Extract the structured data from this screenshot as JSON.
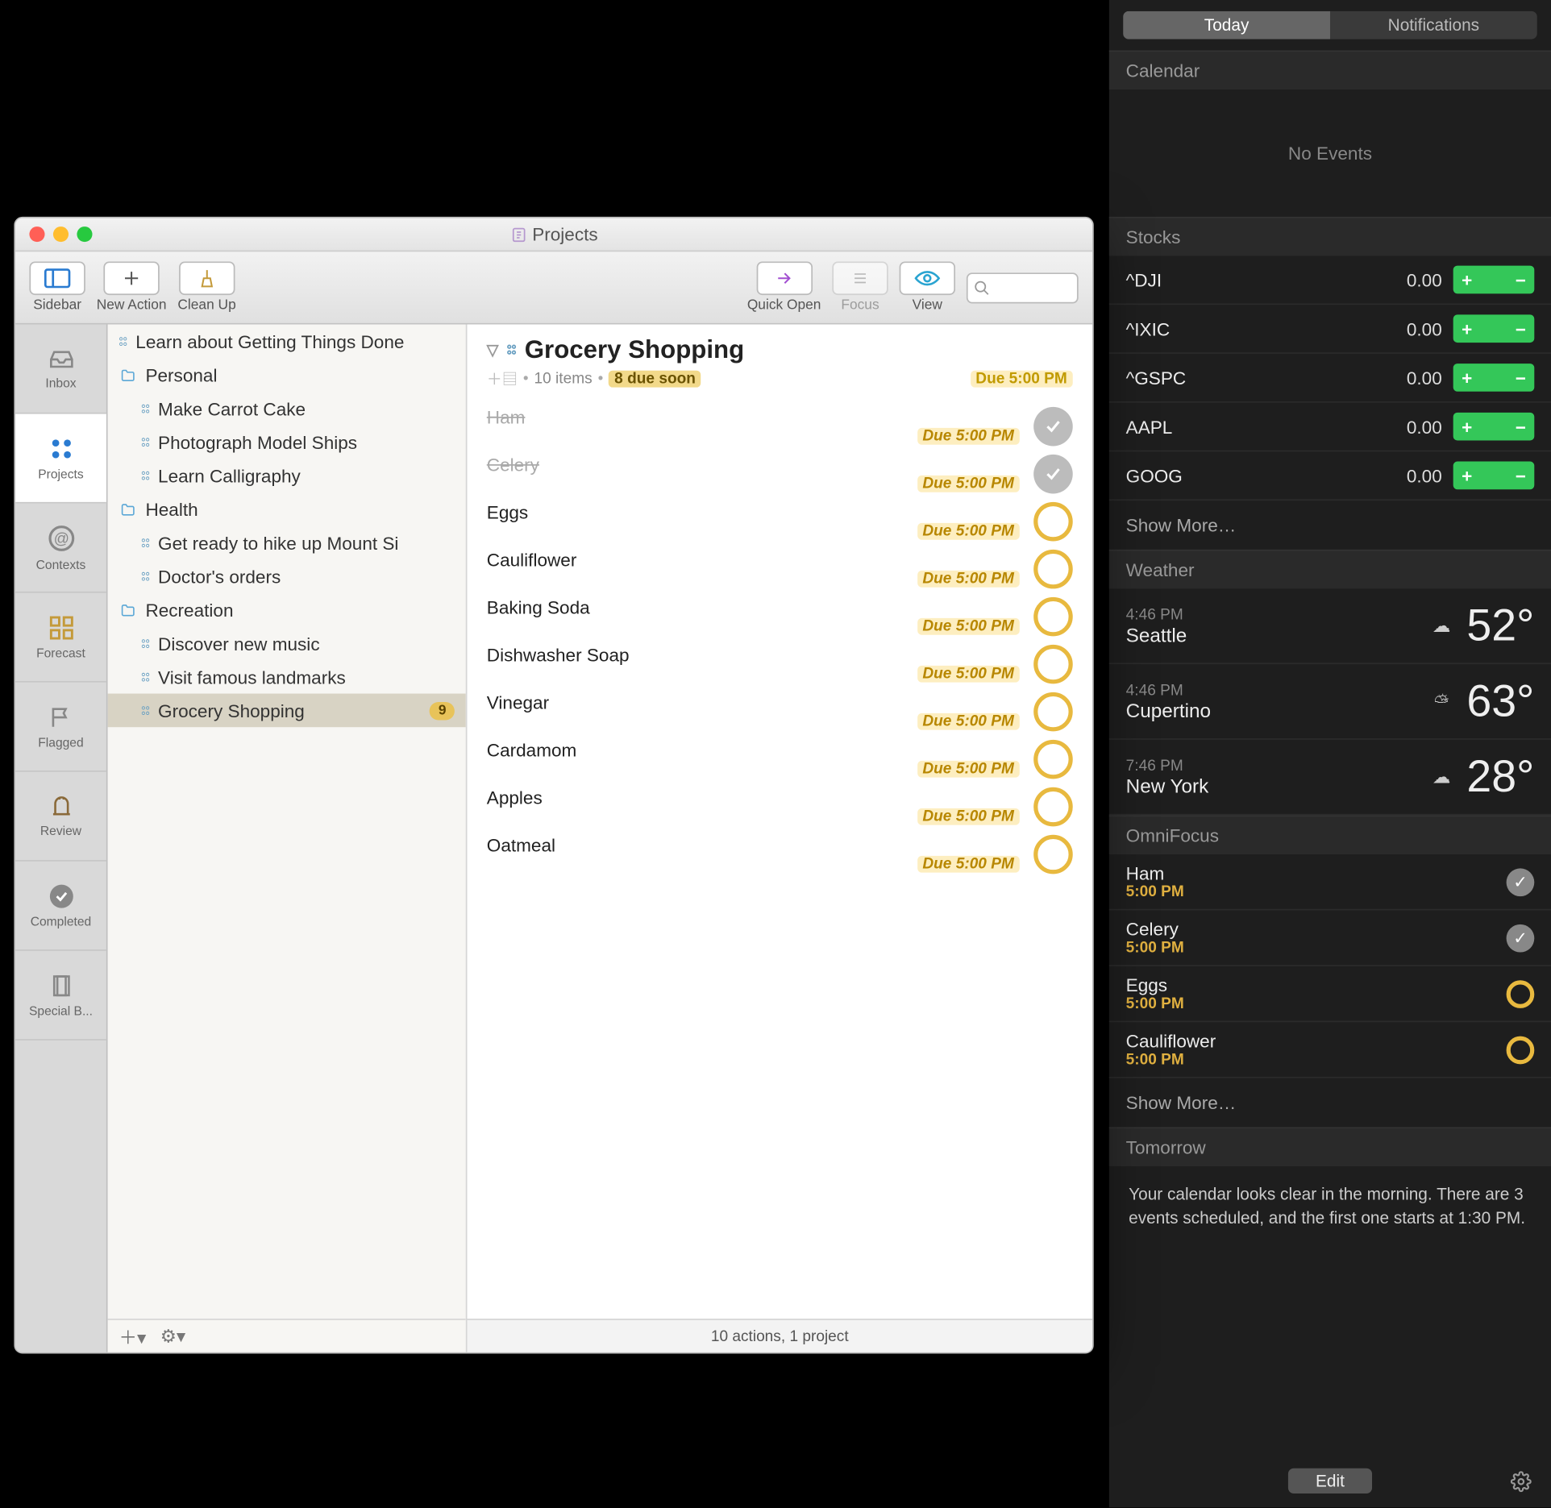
{
  "window": {
    "title": "Projects",
    "toolbar": {
      "sidebar": "Sidebar",
      "new_action": "New Action",
      "clean_up": "Clean Up",
      "quick_open": "Quick Open",
      "focus": "Focus",
      "view": "View"
    },
    "tabs": [
      "Inbox",
      "Projects",
      "Contexts",
      "Forecast",
      "Flagged",
      "Review",
      "Completed",
      "Special B..."
    ],
    "active_tab": 1,
    "projects": {
      "tree": [
        {
          "type": "project",
          "label": "Learn about Getting Things Done"
        },
        {
          "type": "folder",
          "label": "Personal",
          "children": [
            {
              "type": "project",
              "label": "Make Carrot Cake"
            },
            {
              "type": "project",
              "label": "Photograph Model Ships"
            },
            {
              "type": "project",
              "label": "Learn Calligraphy"
            }
          ]
        },
        {
          "type": "folder",
          "label": "Health",
          "children": [
            {
              "type": "project",
              "label": "Get ready to hike up Mount Si"
            },
            {
              "type": "project",
              "label": "Doctor's orders"
            }
          ]
        },
        {
          "type": "folder",
          "label": "Recreation",
          "children": [
            {
              "type": "project",
              "label": "Discover new music"
            },
            {
              "type": "project",
              "label": "Visit famous landmarks"
            },
            {
              "type": "project",
              "label": "Grocery Shopping",
              "badge": "9",
              "selected": true
            }
          ]
        }
      ]
    },
    "detail": {
      "title": "Grocery Shopping",
      "meta_items": "10 items",
      "meta_due_soon": "8 due soon",
      "due_label": "Due 5:00 PM",
      "items": [
        {
          "name": "Ham",
          "done": true,
          "due": "Due 5:00 PM"
        },
        {
          "name": "Celery",
          "done": true,
          "due": "Due 5:00 PM"
        },
        {
          "name": "Eggs",
          "done": false,
          "due": "Due 5:00 PM"
        },
        {
          "name": "Cauliflower",
          "done": false,
          "due": "Due 5:00 PM"
        },
        {
          "name": "Baking Soda",
          "done": false,
          "due": "Due 5:00 PM"
        },
        {
          "name": "Dishwasher Soap",
          "done": false,
          "due": "Due 5:00 PM"
        },
        {
          "name": "Vinegar",
          "done": false,
          "due": "Due 5:00 PM"
        },
        {
          "name": "Cardamom",
          "done": false,
          "due": "Due 5:00 PM"
        },
        {
          "name": "Apples",
          "done": false,
          "due": "Due 5:00 PM"
        },
        {
          "name": "Oatmeal",
          "done": false,
          "due": "Due 5:00 PM"
        }
      ],
      "footer": "10 actions, 1 project"
    }
  },
  "nc": {
    "tabs": {
      "today": "Today",
      "notifications": "Notifications"
    },
    "calendar": {
      "header": "Calendar",
      "empty": "No Events"
    },
    "stocks": {
      "header": "Stocks",
      "rows": [
        {
          "sym": "^DJI",
          "val": "0.00"
        },
        {
          "sym": "^IXIC",
          "val": "0.00"
        },
        {
          "sym": "^GSPC",
          "val": "0.00"
        },
        {
          "sym": "AAPL",
          "val": "0.00"
        },
        {
          "sym": "GOOG",
          "val": "0.00"
        }
      ],
      "show_more": "Show More…"
    },
    "weather": {
      "header": "Weather",
      "rows": [
        {
          "time": "4:46 PM",
          "city": "Seattle",
          "icon": "cloud",
          "temp": "52°"
        },
        {
          "time": "4:46 PM",
          "city": "Cupertino",
          "icon": "partly",
          "temp": "63°"
        },
        {
          "time": "7:46 PM",
          "city": "New York",
          "icon": "cloud",
          "temp": "28°"
        }
      ]
    },
    "omnifocus": {
      "header": "OmniFocus",
      "rows": [
        {
          "title": "Ham",
          "time": "5:00 PM",
          "done": true
        },
        {
          "title": "Celery",
          "time": "5:00 PM",
          "done": true
        },
        {
          "title": "Eggs",
          "time": "5:00 PM",
          "done": false
        },
        {
          "title": "Cauliflower",
          "time": "5:00 PM",
          "done": false
        }
      ],
      "show_more": "Show More…"
    },
    "tomorrow": {
      "header": "Tomorrow",
      "text": "Your calendar looks clear in the morning. There are 3 events scheduled, and the first one starts at 1:30 PM."
    },
    "edit": "Edit"
  }
}
